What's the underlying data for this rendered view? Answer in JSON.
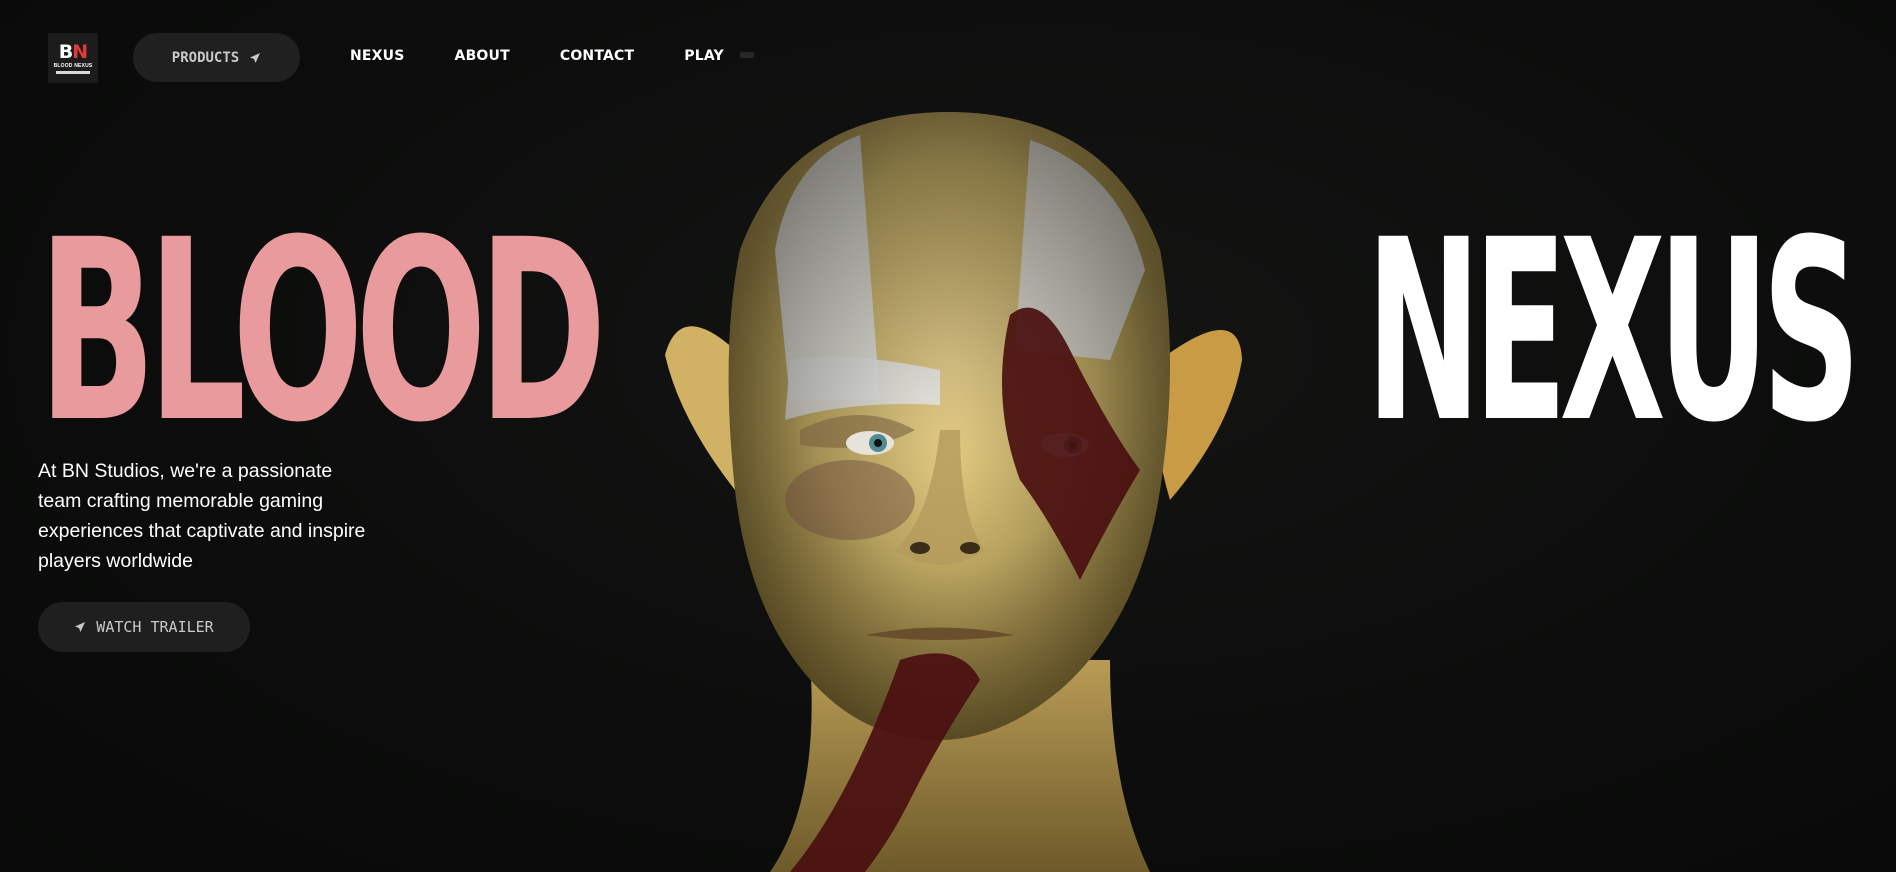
{
  "brand": {
    "logo_text_b": "B",
    "logo_text_n": "N",
    "logo_subtext": "BLOOD NEXUS",
    "accent_pink": "#e89a9c"
  },
  "nav": {
    "products_label": "PRODUCTS",
    "products_icon": "send-arrow-icon",
    "links": [
      {
        "label": "NEXUS"
      },
      {
        "label": "ABOUT"
      },
      {
        "label": "CONTACT"
      },
      {
        "label": "PLAY"
      }
    ]
  },
  "hero": {
    "title_left": "BLOOD",
    "title_right": "NEXUS",
    "description": "At BN Studios, we're a passionate team crafting memorable gaming experiences that captivate and inspire players worldwide",
    "cta_label": "WATCH TRAILER",
    "cta_icon": "send-arrow-icon"
  }
}
